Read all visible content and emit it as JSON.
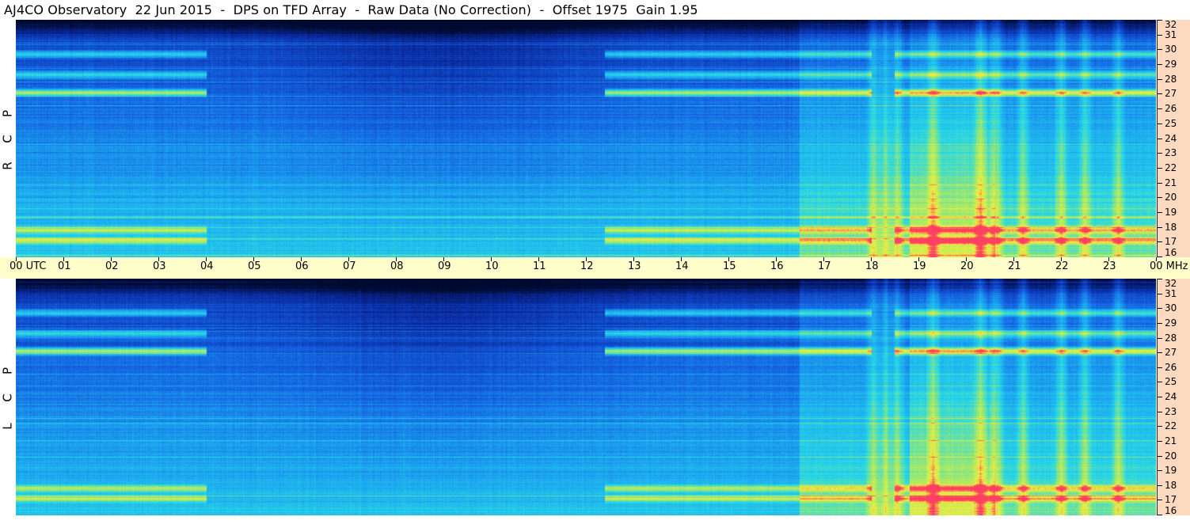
{
  "title": "AJ4CO Observatory  22 Jun 2015  -  DPS on TFD Array  -  Raw Data (No Correction)  -  Offset 1975  Gain 1.95",
  "panels": [
    {
      "id": "top",
      "polarization_letters": [
        "P",
        "C",
        "R"
      ]
    },
    {
      "id": "bottom",
      "polarization_letters": [
        "P",
        "C",
        "L"
      ]
    }
  ],
  "colors": {
    "time_axis_bg": "#ffffcc",
    "freq_axis_bg": "#fcd9bf",
    "colormap": [
      "#000a30",
      "#0a2aa0",
      "#1460e0",
      "#1ca6f0",
      "#28d8e6",
      "#9ae870",
      "#f0f040",
      "#ff4060"
    ]
  },
  "chart_data": {
    "type": "heatmap",
    "title": "AJ4CO Observatory  22 Jun 2015  -  DPS on TFD Array  -  Raw Data (No Correction)  -  Offset 1975  Gain 1.95",
    "xlabel": "UTC",
    "ylabel": "MHz",
    "x_ticks": [
      "00 UTC",
      "01",
      "02",
      "03",
      "04",
      "05",
      "06",
      "07",
      "08",
      "09",
      "10",
      "11",
      "12",
      "13",
      "14",
      "15",
      "16",
      "17",
      "18",
      "19",
      "20",
      "21",
      "22",
      "23",
      "00 MHz"
    ],
    "xlim_hours": [
      0,
      24
    ],
    "y_ticks": [
      "32",
      "31",
      "30",
      "29",
      "28",
      "27",
      "26",
      "25",
      "24",
      "23",
      "22",
      "21",
      "20",
      "19",
      "18",
      "17",
      "16"
    ],
    "ylim_mhz": [
      16,
      32
    ],
    "series": [
      {
        "name": "R C P"
      },
      {
        "name": "L C P"
      }
    ],
    "features": {
      "strong_bands_mhz": [
        27.1,
        28.3,
        29.7,
        17.8,
        17.1
      ],
      "bands_active_hours": [
        [
          0,
          4.0
        ],
        [
          12.4,
          18.0
        ],
        [
          18.5,
          24
        ]
      ],
      "daytime_enhancement_hours": [
        16.5,
        24
      ],
      "bright_vertical_bursts_hours": [
        18.05,
        18.3,
        18.55,
        19.3,
        20.3,
        20.65,
        21.2,
        22.0,
        22.5,
        23.2
      ]
    }
  }
}
